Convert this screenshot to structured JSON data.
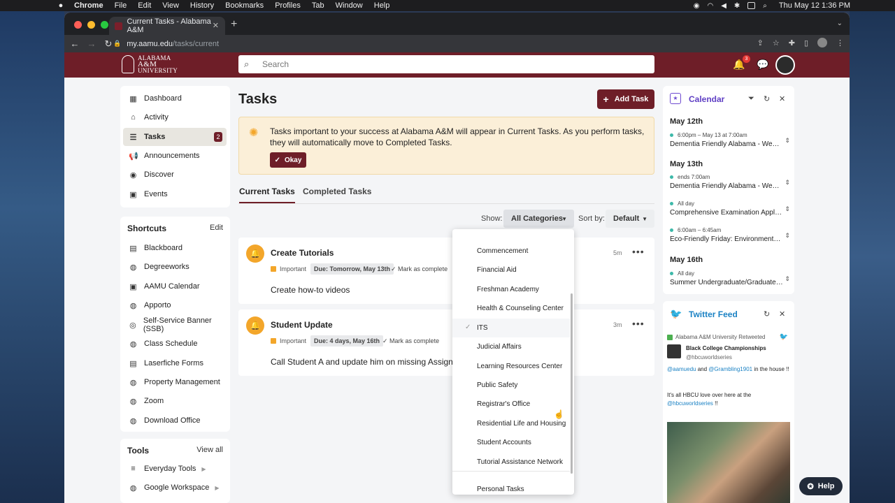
{
  "mac_menu": {
    "app": "Chrome",
    "items": [
      "File",
      "Edit",
      "View",
      "History",
      "Bookmarks",
      "Profiles",
      "Tab",
      "Window",
      "Help"
    ],
    "clock": "Thu May 12  1:36 PM"
  },
  "browser": {
    "tab_title": "Current Tasks - Alabama A&M",
    "url_host": "my.aamu.edu",
    "url_path": "/tasks/current"
  },
  "header": {
    "logo_lines": [
      "ALABAMA",
      "A&M",
      "UNIVERSITY"
    ],
    "search_placeholder": "Search",
    "notification_count": "3"
  },
  "nav": [
    {
      "label": "Dashboard",
      "icon": "dashboard-icon",
      "glyph": "▦"
    },
    {
      "label": "Activity",
      "icon": "home-icon",
      "glyph": "⌂"
    },
    {
      "label": "Tasks",
      "icon": "tasks-icon",
      "glyph": "☰",
      "badge": "2",
      "active": true
    },
    {
      "label": "Announcements",
      "icon": "megaphone-icon",
      "glyph": "📢"
    },
    {
      "label": "Discover",
      "icon": "compass-icon",
      "glyph": "◉"
    },
    {
      "label": "Events",
      "icon": "calendar-icon",
      "glyph": "▣"
    }
  ],
  "shortcuts": {
    "title": "Shortcuts",
    "edit": "Edit",
    "items": [
      {
        "label": "Blackboard",
        "icon": "blackboard-icon",
        "glyph": "▤"
      },
      {
        "label": "Degreeworks",
        "icon": "globe-icon",
        "glyph": "◍"
      },
      {
        "label": "AAMU Calendar",
        "icon": "calendar-icon",
        "glyph": "▣"
      },
      {
        "label": "Apporto",
        "icon": "globe-icon",
        "glyph": "◍"
      },
      {
        "label": "Self-Service Banner (SSB)",
        "icon": "banner-icon",
        "glyph": "◎"
      },
      {
        "label": "Class Schedule",
        "icon": "globe-icon",
        "glyph": "◍"
      },
      {
        "label": "Laserfiche Forms",
        "icon": "document-icon",
        "glyph": "▤"
      },
      {
        "label": "Property Management",
        "icon": "globe-icon",
        "glyph": "◍"
      },
      {
        "label": "Zoom",
        "icon": "globe-icon",
        "glyph": "◍"
      },
      {
        "label": "Download Office",
        "icon": "globe-icon",
        "glyph": "◍"
      }
    ]
  },
  "tools": {
    "title": "Tools",
    "view_all": "View all",
    "items": [
      {
        "label": "Everyday Tools",
        "icon": "list-icon",
        "glyph": "≡"
      },
      {
        "label": "Google Workspace",
        "icon": "globe-icon",
        "glyph": "◍"
      }
    ]
  },
  "main": {
    "title": "Tasks",
    "add_task": "Add Task",
    "banner_text": "Tasks important to your success at Alabama A&M will appear in Current Tasks. As you perform tasks, they will automatically move to Completed Tasks.",
    "okay": "Okay",
    "tabs": [
      "Current Tasks",
      "Completed Tasks"
    ],
    "show_label": "Show:",
    "category": "All Categories",
    "sort_label": "Sort by:",
    "sort": "Default"
  },
  "tasks": [
    {
      "title": "Create Tutorials",
      "important": "Important",
      "due": "Due: Tomorrow, May 13th",
      "mark": "Mark as complete",
      "desc": "Create how-to videos",
      "age": "5m"
    },
    {
      "title": "Student Update",
      "important": "Important",
      "due": "Due: 4 days, May 16th",
      "mark": "Mark as complete",
      "desc": "Call Student A and update him on missing Assignme",
      "age": "3m"
    }
  ],
  "categories": {
    "items": [
      "Commencement",
      "Financial Aid",
      "Freshman Academy",
      "Health & Counseling Center",
      "ITS",
      "Judicial Affairs",
      "Learning Resources Center",
      "Public Safety",
      "Registrar's Office",
      "Residential Life and Housing",
      "Student Accounts",
      "Tutorial Assistance Network"
    ],
    "selected": "ITS",
    "extra": "Personal Tasks"
  },
  "calendar": {
    "title": "Calendar",
    "days": [
      {
        "label": "May 12th",
        "events": [
          {
            "time": "6:00pm – May 13 at 7:00am",
            "title": "Dementia Friendly Alabama - Webi..."
          }
        ]
      },
      {
        "label": "May 13th",
        "events": [
          {
            "time": "ends 7:00am",
            "title": "Dementia Friendly Alabama - Webi..."
          },
          {
            "time": "All day",
            "title": "Comprehensive Examination Applic..."
          },
          {
            "time": "6:00am – 6:45am",
            "title": "Eco-Friendly Friday: Environmental ..."
          }
        ]
      },
      {
        "label": "May 16th",
        "events": [
          {
            "time": "All day",
            "title": "Summer Undergraduate/Graduate ..."
          }
        ]
      }
    ]
  },
  "twitter": {
    "title": "Twitter Feed",
    "retweet": "Alabama A&M University Retweeted",
    "account_name": "Black College Championships",
    "account_handle": "@hbcuworldseries",
    "line1_a": "@aamuedu",
    "line1_b": " and ",
    "line1_c": "@Grambling1901",
    "line1_d": " in the house !!",
    "line2": "It's all HBCU love over here at the",
    "line3_a": "@hbcuworldseries",
    "line3_b": " !!"
  },
  "help": "Help",
  "colors": {
    "brand": "#6e1e28",
    "calendar_accent": "#5f3fc4",
    "twitter": "#1da1f2",
    "warning": "#f3a62a"
  }
}
